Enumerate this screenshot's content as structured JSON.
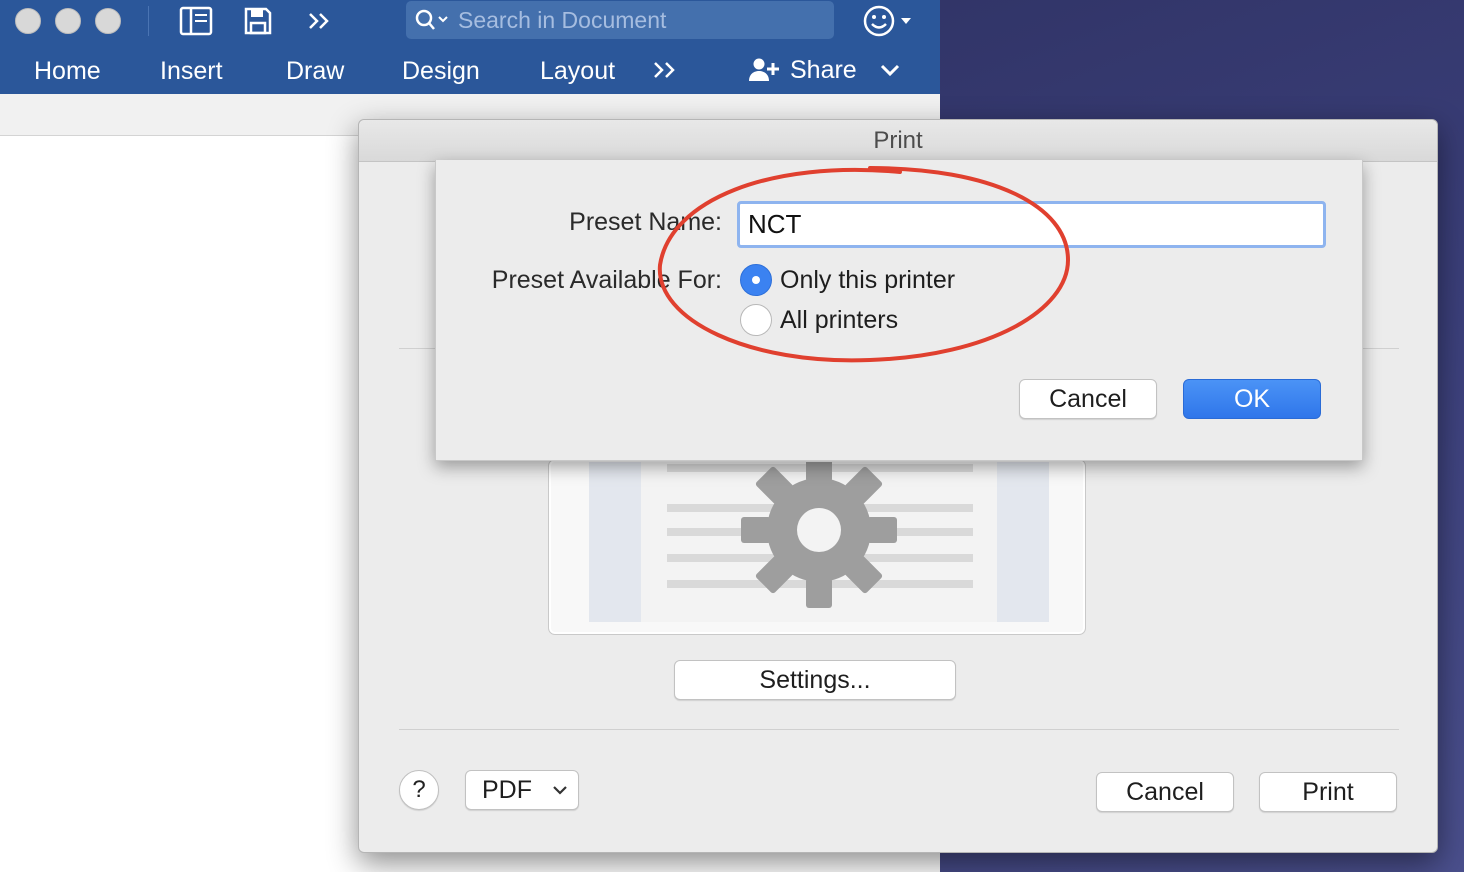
{
  "word": {
    "search": {
      "placeholder": "Search in Document"
    },
    "tabs": [
      {
        "label": "Home"
      },
      {
        "label": "Insert"
      },
      {
        "label": "Draw"
      },
      {
        "label": "Design"
      },
      {
        "label": "Layout"
      }
    ],
    "more_tabs": "»",
    "share_label": "Share",
    "icons": {
      "sidebar": "sidebar-icon",
      "save": "save-icon",
      "more": "double-chevron-icon",
      "search": "search-icon",
      "smiley": "smiley-icon"
    }
  },
  "print_dialog": {
    "title": "Print",
    "settings_button": "Settings...",
    "help_button": "?",
    "pdf_button": "PDF",
    "cancel_button": "Cancel",
    "print_button": "Print"
  },
  "preset_sheet": {
    "name_label": "Preset Name:",
    "name_value": "NCT",
    "available_label": "Preset Available For:",
    "options": [
      {
        "label": "Only this printer",
        "selected": true
      },
      {
        "label": "All printers",
        "selected": false
      }
    ],
    "cancel_button": "Cancel",
    "ok_button": "OK"
  },
  "colors": {
    "ribbon": "#2b579a",
    "accent_blue": "#3b82f1",
    "annotation_red": "#e0402f"
  }
}
